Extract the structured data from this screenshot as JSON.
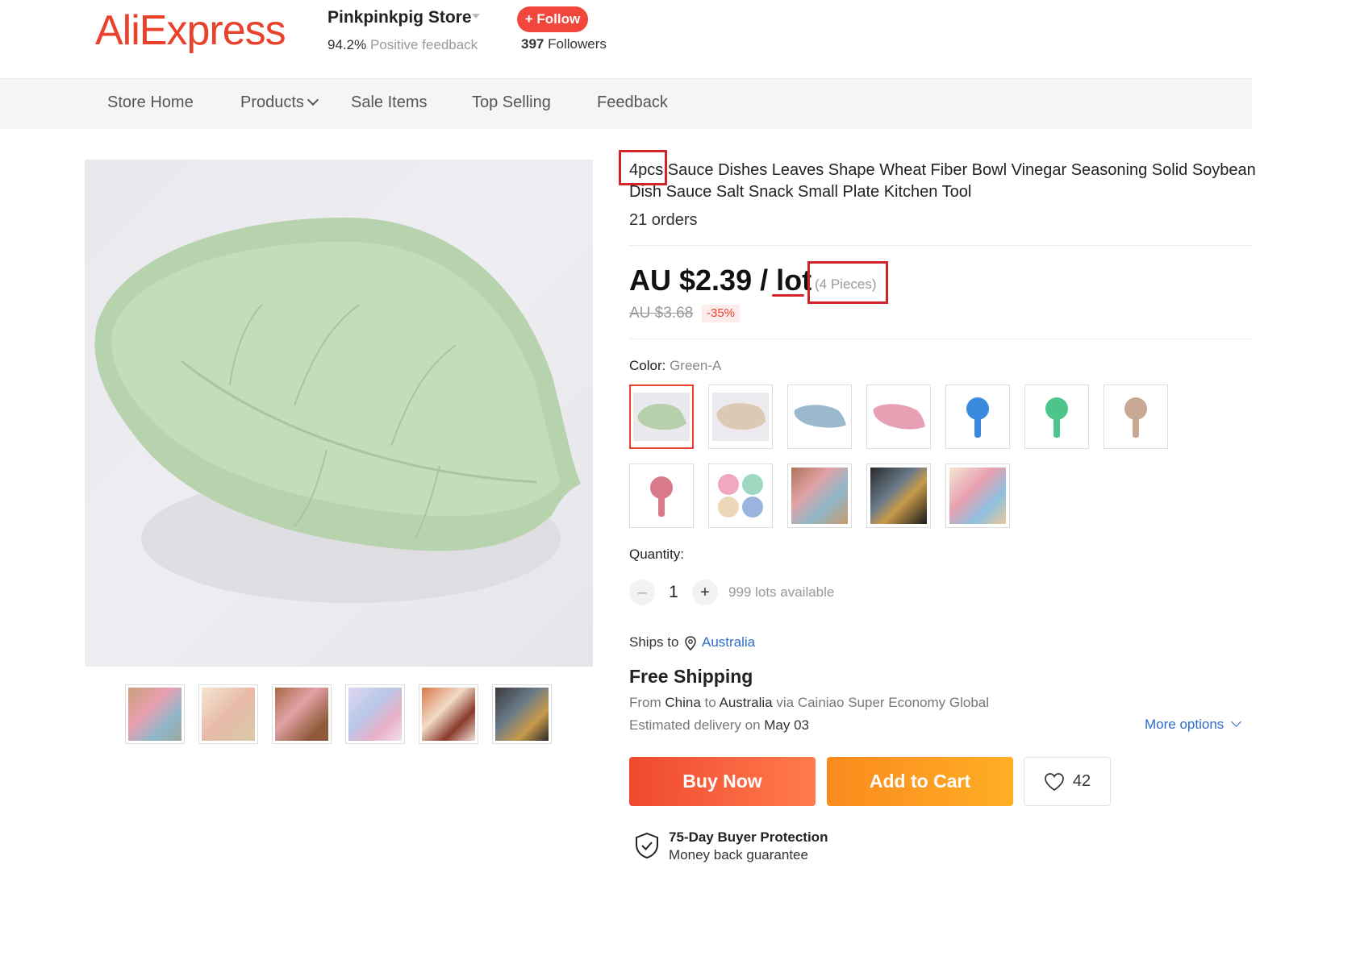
{
  "header": {
    "logo": "AliExpress",
    "store_name": "Pinkpinkpig Store",
    "feedback_pct": "94.2%",
    "feedback_label": "Positive feedback",
    "follow_label": "+ Follow",
    "followers_count": "397",
    "followers_label": "Followers"
  },
  "nav": {
    "items": [
      "Store Home",
      "Products",
      "Sale Items",
      "Top Selling",
      "Feedback"
    ]
  },
  "product": {
    "title_prefix": "4pcs",
    "title_rest": " Sauce Dishes Leaves Shape Wheat Fiber Bowl Vinegar Seasoning Solid Soybean Dish Sauce Salt Snack Small Plate Kitchen Tool",
    "orders": "21 orders",
    "price": "AU $2.39 / ",
    "price_unit": "lot",
    "pieces": "(4 Pieces)",
    "old_price": "AU $3.68",
    "discount": "-35%",
    "color_label": "Color: ",
    "color_value": "Green-A",
    "quantity_label": "Quantity:",
    "quantity_minus": "–",
    "quantity_value": "1",
    "quantity_plus": "+",
    "available": "999 lots available",
    "ships_to_label": "Ships to",
    "ships_to_value": "Australia",
    "free_shipping": "Free Shipping",
    "route_from": "From ",
    "route_origin": "China",
    "route_to": " to ",
    "route_dest": "Australia",
    "route_via": " via Cainiao Super Economy Global",
    "delivery_label": "Estimated delivery on ",
    "delivery_date": "May 03",
    "more_options": "More options",
    "buy_now": "Buy Now",
    "add_to_cart": "Add to Cart",
    "wishlist_count": "42",
    "protection_title": "75-Day Buyer Protection",
    "protection_sub": "Money back guarantee"
  },
  "colors": {
    "brand": "#e8412c",
    "link": "#2e6cc7",
    "highlight": "#d2232a"
  },
  "icons": [
    "chevron-down-icon",
    "location-pin-icon",
    "heart-icon",
    "shield-check-icon",
    "plus-icon",
    "minus-icon"
  ]
}
